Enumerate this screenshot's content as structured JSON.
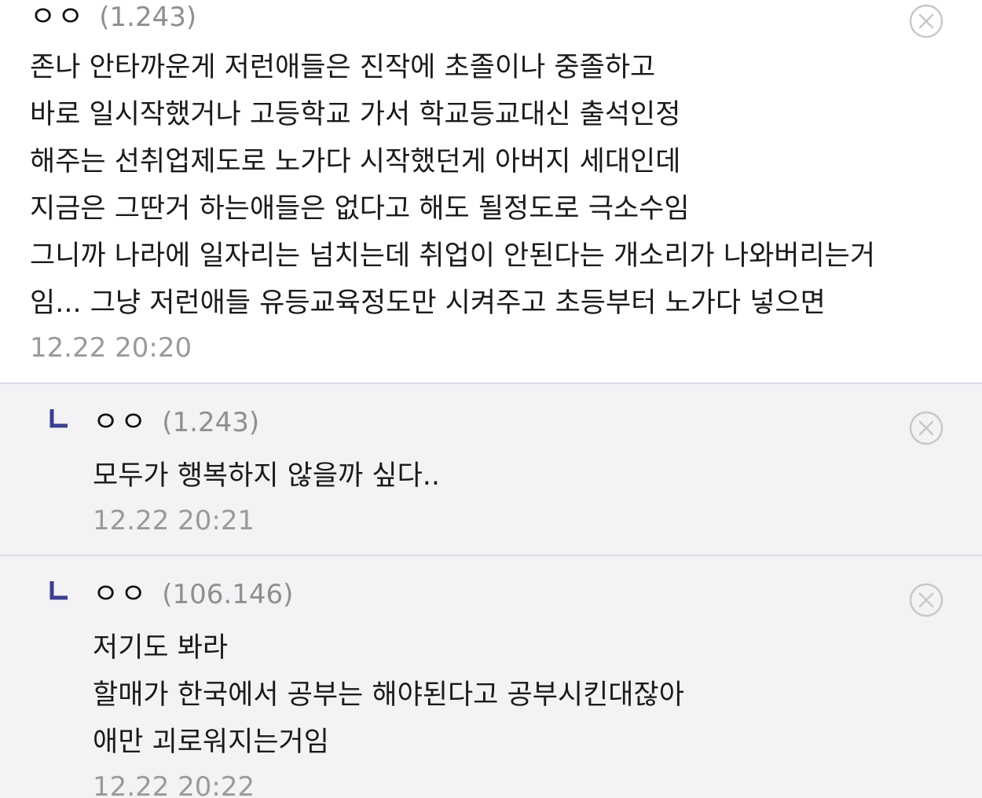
{
  "comments": [
    {
      "author": "ㅇㅇ",
      "ip": "(1.243)",
      "lines": [
        "존나 안타까운게 저런애들은 진작에 초졸이나 중졸하고",
        "바로 일시작했거나 고등학교 가서 학교등교대신 출석인정",
        "해주는 선취업제도로 노가다 시작했던게 아버지 세대인데",
        "지금은 그딴거 하는애들은 없다고 해도 될정도로 극소수임",
        "그니까 나라에 일자리는 넘치는데 취업이 안된다는 개소리가 나와버리는거",
        "임... 그냥 저런애들 유등교육정도만 시켜주고 초등부터 노가다 넣으면"
      ],
      "timestamp": "12.22 20:20",
      "delete_icon": "close-circle-icon"
    },
    {
      "author": "ㅇㅇ",
      "ip": "(1.243)",
      "lines": [
        "모두가 행복하지 않을까 싶다.."
      ],
      "timestamp": "12.22 20:21",
      "reply_icon": "reply-arrow-icon",
      "delete_icon": "close-circle-icon"
    },
    {
      "author": "ㅇㅇ",
      "ip": "(106.146)",
      "lines": [
        "저기도 봐라",
        "할매가 한국에서 공부는 해야된다고 공부시킨대잖아",
        "애만 괴로워지는거임"
      ],
      "timestamp": "12.22 20:22",
      "reply_icon": "reply-arrow-icon",
      "delete_icon": "close-circle-icon"
    }
  ],
  "colors": {
    "reply_background": "#f3f3f6",
    "divider": "#d9dbe6",
    "reply_icon": "#3b3f8f",
    "muted_text": "#9a9a9a"
  }
}
